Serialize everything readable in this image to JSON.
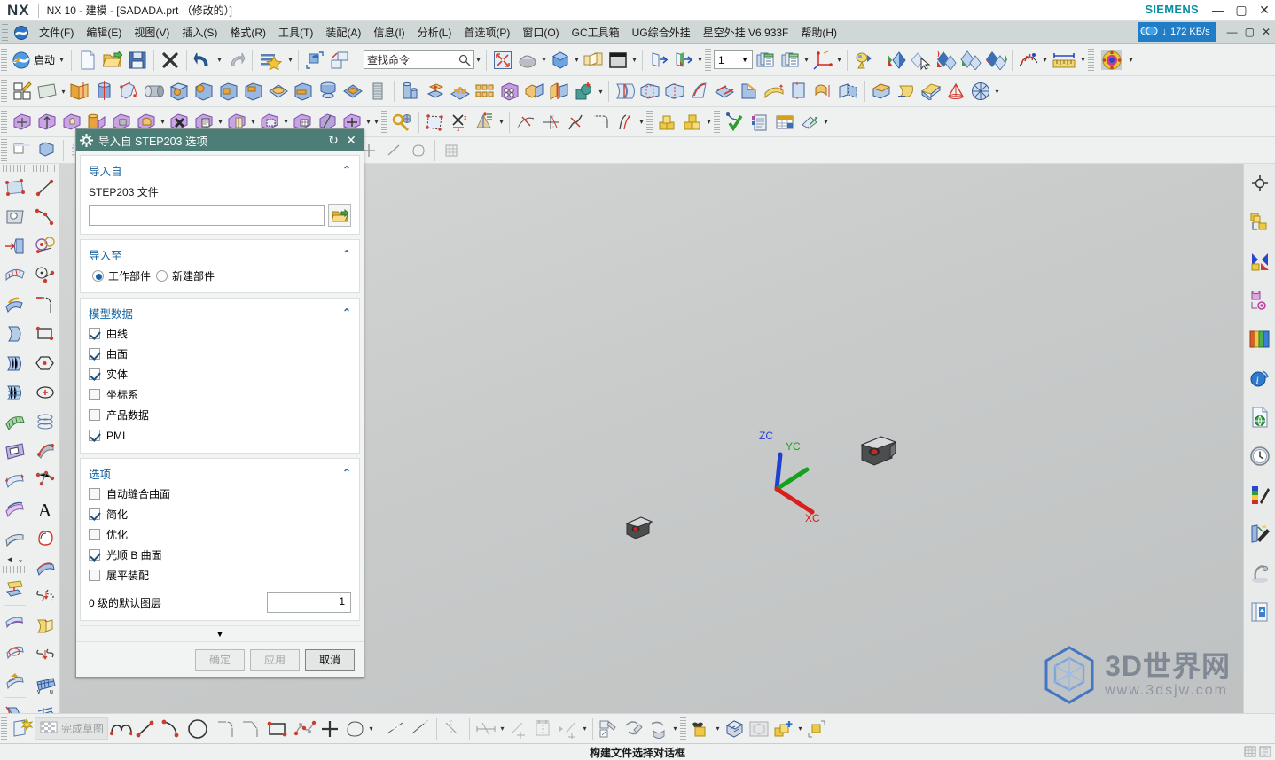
{
  "titlebar": {
    "logo": "NX",
    "title": "NX 10 - 建模 - [SADADA.prt （修改的）]",
    "brand": "SIEMENS",
    "minimize": "—",
    "maximize": "▢",
    "close": "✕"
  },
  "menubar": {
    "app_icon": "nx-app-icon",
    "items": [
      {
        "label": "文件(F)"
      },
      {
        "label": "编辑(E)"
      },
      {
        "label": "视图(V)"
      },
      {
        "label": "插入(S)"
      },
      {
        "label": "格式(R)"
      },
      {
        "label": "工具(T)"
      },
      {
        "label": "装配(A)"
      },
      {
        "label": "信息(I)"
      },
      {
        "label": "分析(L)"
      },
      {
        "label": "首选项(P)"
      },
      {
        "label": "窗口(O)"
      },
      {
        "label": "GC工具箱"
      },
      {
        "label": "UG综合外挂"
      },
      {
        "label": "星空外挂 V6.933F"
      },
      {
        "label": "帮助(H)"
      }
    ],
    "network_badge": "172 KB/s",
    "network_arrow": "↓",
    "doc_minimize": "—",
    "doc_maximize": "▢",
    "doc_close": "✕"
  },
  "toolbar": {
    "start_label": "启动",
    "search_placeholder": "查找命令",
    "search_value": "查找命令",
    "layer_value": "1"
  },
  "graphics": {
    "triad": {
      "zc": "ZC",
      "yc": "YC",
      "xc": "XC",
      "colors": {
        "x": "#d81f1f",
        "y": "#16a11c",
        "z": "#1134c9",
        "label_z": "#2a3fd0",
        "label_y": "#14a21a",
        "label_x": "#d81f1f"
      }
    },
    "watermark": {
      "main": "3D世界网",
      "sub": "www.3dsjw.com"
    },
    "background_color": "#cacccc"
  },
  "dialog": {
    "title": "导入自 STEP203 选项",
    "gear_icon": "gear-icon",
    "reset_icon": "reset-icon",
    "close_icon": "close-icon",
    "collapse_glyph": "⌃",
    "groups": [
      {
        "id": "import_from",
        "title": "导入自",
        "file_label": "STEP203 文件",
        "file_value": "",
        "browse_icon": "open-folder-icon"
      },
      {
        "id": "import_to",
        "title": "导入至",
        "radios": [
          {
            "label": "工作部件",
            "checked": true
          },
          {
            "label": "新建部件",
            "checked": false
          }
        ]
      },
      {
        "id": "model_data",
        "title": "模型数据",
        "checkboxes": [
          {
            "label": "曲线",
            "checked": true
          },
          {
            "label": "曲面",
            "checked": true
          },
          {
            "label": "实体",
            "checked": true
          },
          {
            "label": "坐标系",
            "checked": false
          },
          {
            "label": "产品数据",
            "checked": false
          },
          {
            "label": "PMI",
            "checked": true
          }
        ]
      },
      {
        "id": "options",
        "title": "选项",
        "checkboxes": [
          {
            "label": "自动缝合曲面",
            "checked": false
          },
          {
            "label": "简化",
            "checked": true
          },
          {
            "label": "优化",
            "checked": false
          },
          {
            "label": "光顺 B 曲面",
            "checked": true
          },
          {
            "label": "展平装配",
            "checked": false
          }
        ],
        "layer_label": "0 级的默认图层",
        "layer_value": "1"
      }
    ],
    "expand_glyph": "▼",
    "buttons": [
      {
        "label": "确定",
        "enabled": false
      },
      {
        "label": "应用",
        "enabled": false
      },
      {
        "label": "取消",
        "enabled": true
      }
    ]
  },
  "bottombar": {
    "finish_sketch_label": "完成草图"
  },
  "statusbar": {
    "message": "构建文件选择对话框"
  }
}
